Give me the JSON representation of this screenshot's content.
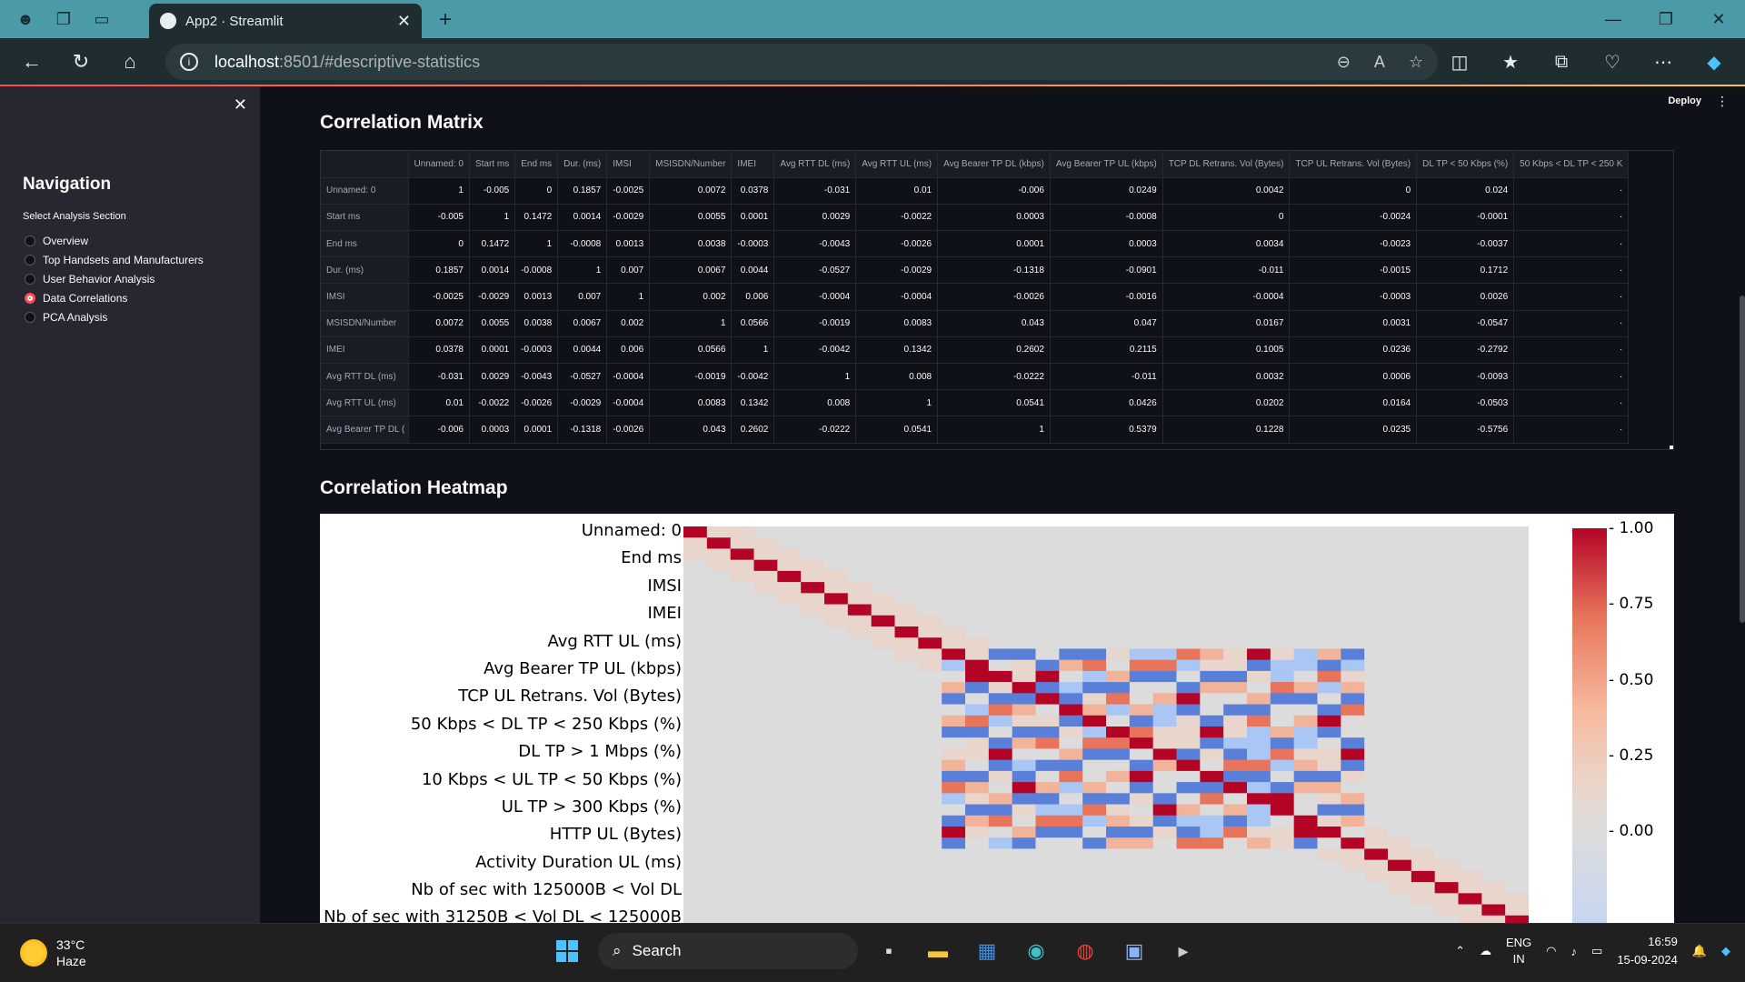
{
  "browser": {
    "tab_title": "App2 · Streamlit",
    "url_host": "localhost",
    "url_rest": ":8501/#descriptive-statistics"
  },
  "app": {
    "deploy_label": "Deploy",
    "menu_icon": "kebab-icon"
  },
  "sidebar": {
    "title": "Navigation",
    "radio_label": "Select Analysis Section",
    "options": [
      "Overview",
      "Top Handsets and Manufacturers",
      "User Behavior Analysis",
      "Data Correlations",
      "PCA Analysis"
    ],
    "selected": "Data Correlations"
  },
  "main": {
    "matrix_heading": "Correlation Matrix",
    "heatmap_heading": "Correlation Heatmap"
  },
  "table": {
    "columns": [
      "Unnamed: 0",
      "Start ms",
      "End ms",
      "Dur. (ms)",
      "IMSI",
      "MSISDN/Number",
      "IMEI",
      "Avg RTT DL (ms)",
      "Avg RTT UL (ms)",
      "Avg Bearer TP DL (kbps)",
      "Avg Bearer TP UL (kbps)",
      "TCP DL Retrans. Vol (Bytes)",
      "TCP UL Retrans. Vol (Bytes)",
      "DL TP < 50 Kbps (%)",
      "50 Kbps < DL TP < 250 K"
    ],
    "rows": [
      {
        "label": "Unnamed: 0",
        "values": [
          "1",
          "-0.005",
          "0",
          "0.1857",
          "-0.0025",
          "0.0072",
          "0.0378",
          "-0.031",
          "0.01",
          "-0.006",
          "0.0249",
          "0.0042",
          "0",
          "0.024",
          "·"
        ]
      },
      {
        "label": "Start ms",
        "values": [
          "-0.005",
          "1",
          "0.1472",
          "0.0014",
          "-0.0029",
          "0.0055",
          "0.0001",
          "0.0029",
          "-0.0022",
          "0.0003",
          "-0.0008",
          "0",
          "-0.0024",
          "-0.0001",
          "·"
        ]
      },
      {
        "label": "End ms",
        "values": [
          "0",
          "0.1472",
          "1",
          "-0.0008",
          "0.0013",
          "0.0038",
          "-0.0003",
          "-0.0043",
          "-0.0026",
          "0.0001",
          "0.0003",
          "0.0034",
          "-0.0023",
          "-0.0037",
          "·"
        ]
      },
      {
        "label": "Dur. (ms)",
        "values": [
          "0.1857",
          "0.0014",
          "-0.0008",
          "1",
          "0.007",
          "0.0067",
          "0.0044",
          "-0.0527",
          "-0.0029",
          "-0.1318",
          "-0.0901",
          "-0.011",
          "-0.0015",
          "0.1712",
          "·"
        ]
      },
      {
        "label": "IMSI",
        "values": [
          "-0.0025",
          "-0.0029",
          "0.0013",
          "0.007",
          "1",
          "0.002",
          "0.006",
          "-0.0004",
          "-0.0004",
          "-0.0026",
          "-0.0016",
          "-0.0004",
          "-0.0003",
          "0.0026",
          "·"
        ]
      },
      {
        "label": "MSISDN/Number",
        "values": [
          "0.0072",
          "0.0055",
          "0.0038",
          "0.0067",
          "0.002",
          "1",
          "0.0566",
          "-0.0019",
          "0.0083",
          "0.043",
          "0.047",
          "0.0167",
          "0.0031",
          "-0.0547",
          "·"
        ]
      },
      {
        "label": "IMEI",
        "values": [
          "0.0378",
          "0.0001",
          "-0.0003",
          "0.0044",
          "0.006",
          "0.0566",
          "1",
          "-0.0042",
          "0.1342",
          "0.2602",
          "0.2115",
          "0.1005",
          "0.0236",
          "-0.2792",
          "·"
        ]
      },
      {
        "label": "Avg RTT DL (ms)",
        "values": [
          "-0.031",
          "0.0029",
          "-0.0043",
          "-0.0527",
          "-0.0004",
          "-0.0019",
          "-0.0042",
          "1",
          "0.008",
          "-0.0222",
          "-0.011",
          "0.0032",
          "0.0006",
          "-0.0093",
          "·"
        ]
      },
      {
        "label": "Avg RTT UL (ms)",
        "values": [
          "0.01",
          "-0.0022",
          "-0.0026",
          "-0.0029",
          "-0.0004",
          "0.0083",
          "0.1342",
          "0.008",
          "1",
          "0.0541",
          "0.0426",
          "0.0202",
          "0.0164",
          "-0.0503",
          "·"
        ]
      },
      {
        "label": "Avg Bearer TP DL (",
        "values": [
          "-0.006",
          "0.0003",
          "0.0001",
          "-0.1318",
          "-0.0026",
          "0.043",
          "0.2602",
          "-0.0222",
          "0.0541",
          "1",
          "0.5379",
          "0.1228",
          "0.0235",
          "-0.5756",
          "·"
        ]
      }
    ]
  },
  "heatmap": {
    "row_labels": [
      "Unnamed: 0",
      "End ms",
      "IMSI",
      "IMEI",
      "Avg RTT UL (ms)",
      "Avg Bearer TP UL (kbps)",
      "TCP UL Retrans. Vol (Bytes)",
      "50 Kbps < DL TP < 250 Kbps (%)",
      "DL TP > 1 Mbps (%)",
      "10 Kbps < UL TP < 50 Kbps (%)",
      "UL TP > 300 Kbps (%)",
      "HTTP UL (Bytes)",
      "Activity Duration UL (ms)",
      "Nb of sec with 125000B < Vol DL",
      "Nb of sec with 31250B < Vol DL < 125000B"
    ],
    "colorbar_ticks": [
      "1.00",
      "0.75",
      "0.50",
      "0.25",
      "0.00"
    ],
    "colorbar_values": [
      1.0,
      0.75,
      0.5,
      0.25,
      0.0
    ],
    "colormap": "coolwarm"
  },
  "taskbar": {
    "temperature": "33°C",
    "condition": "Haze",
    "search_placeholder": "Search",
    "lang_top": "ENG",
    "lang_bottom": "IN",
    "time": "16:59",
    "date": "15-09-2024"
  }
}
